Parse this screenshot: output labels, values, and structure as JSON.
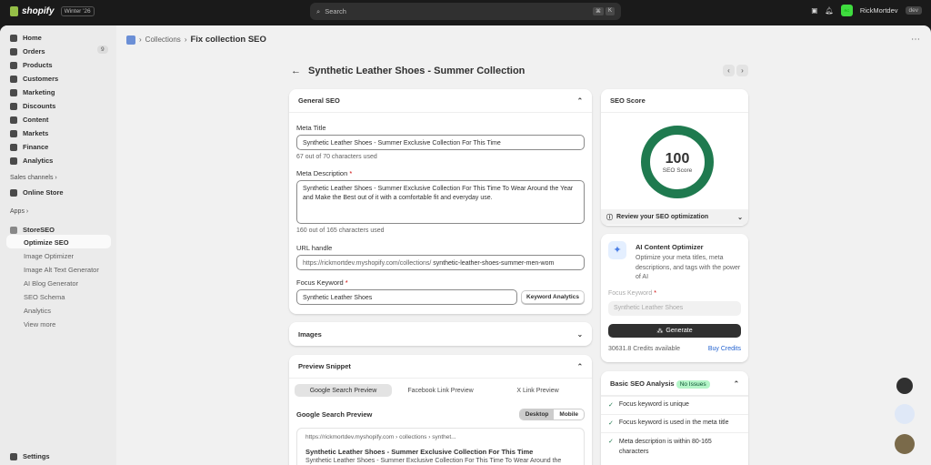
{
  "topbar": {
    "brand": "shopify",
    "version": "Winter '26",
    "search_placeholder": "Search",
    "kbd": [
      "⌘",
      "K"
    ],
    "user": "RickMortdev",
    "user_initials": "RC",
    "env": "dev"
  },
  "sidebar": {
    "items": [
      {
        "label": "Home"
      },
      {
        "label": "Orders",
        "badge": "9"
      },
      {
        "label": "Products"
      },
      {
        "label": "Customers"
      },
      {
        "label": "Marketing"
      },
      {
        "label": "Discounts"
      },
      {
        "label": "Content"
      },
      {
        "label": "Markets"
      },
      {
        "label": "Finance"
      },
      {
        "label": "Analytics"
      }
    ],
    "sales_channels": "Sales channels ›",
    "online_store": "Online Store",
    "apps": "Apps ›",
    "app_name": "StoreSEO",
    "app_items": [
      "Optimize SEO",
      "Image Optimizer",
      "Image Alt Text Generator",
      "AI Blog Generator",
      "SEO Schema",
      "Analytics",
      "View more"
    ],
    "settings": "Settings"
  },
  "breadcrumb": {
    "parent": "Collections",
    "current": "Fix collection SEO"
  },
  "page": {
    "title": "Synthetic Leather Shoes - Summer Collection"
  },
  "general_seo": {
    "title": "General SEO",
    "meta_title_label": "Meta Title",
    "meta_title": "Synthetic Leather Shoes - Summer Exclusive Collection For This Time",
    "meta_title_help": "67 out of 70 characters used",
    "meta_desc_label": "Meta Description",
    "meta_desc": "Synthetic Leather Shoes - Summer Exclusive Collection For This Time To Wear Around the Year and Make the Best out of it with a comfortable fit and everyday use.",
    "meta_desc_help": "160 out of 165 characters used",
    "url_label": "URL handle",
    "url_prefix": "https://rickmortdev.myshopify.com/collections/",
    "url_handle": "synthetic-leather-shoes-summer-men-wom",
    "focus_label": "Focus Keyword",
    "focus_value": "Synthetic Leather Shoes",
    "keyword_analytics": "Keyword Analytics"
  },
  "images": {
    "title": "Images"
  },
  "preview": {
    "title": "Preview Snippet",
    "tabs": [
      "Google Search Preview",
      "Facebook Link Preview",
      "X Link Preview"
    ],
    "subtitle": "Google Search Preview",
    "devices": [
      "Desktop",
      "Mobile"
    ],
    "url": "https://rickmortdev.myshopify.com",
    "crumb1": "collections",
    "crumb2": "synthet...",
    "result_title": "Synthetic Leather Shoes - Summer Exclusive Collection For This Time",
    "result_desc": "Synthetic Leather Shoes - Summer Exclusive Collection For This Time To Wear Around the"
  },
  "score": {
    "title": "SEO Score",
    "value": "100",
    "label": "SEO Score",
    "review": "Review your SEO optimization",
    "color": "#1f7a4f"
  },
  "ai": {
    "title": "AI Content Optimizer",
    "desc": "Optimize your meta titles, meta descriptions, and tags with the power of AI",
    "focus_label": "Focus Keyword",
    "placeholder": "Synthetic Leather Shoes",
    "generate": "Generate",
    "credits": "30631.8 Credits available",
    "buy": "Buy Credits"
  },
  "analysis": {
    "title": "Basic SEO Analysis",
    "badge": "No Issues",
    "checks": [
      "Focus keyword is unique",
      "Focus keyword is used in the meta title",
      "Meta description is within 80-165 characters"
    ]
  }
}
